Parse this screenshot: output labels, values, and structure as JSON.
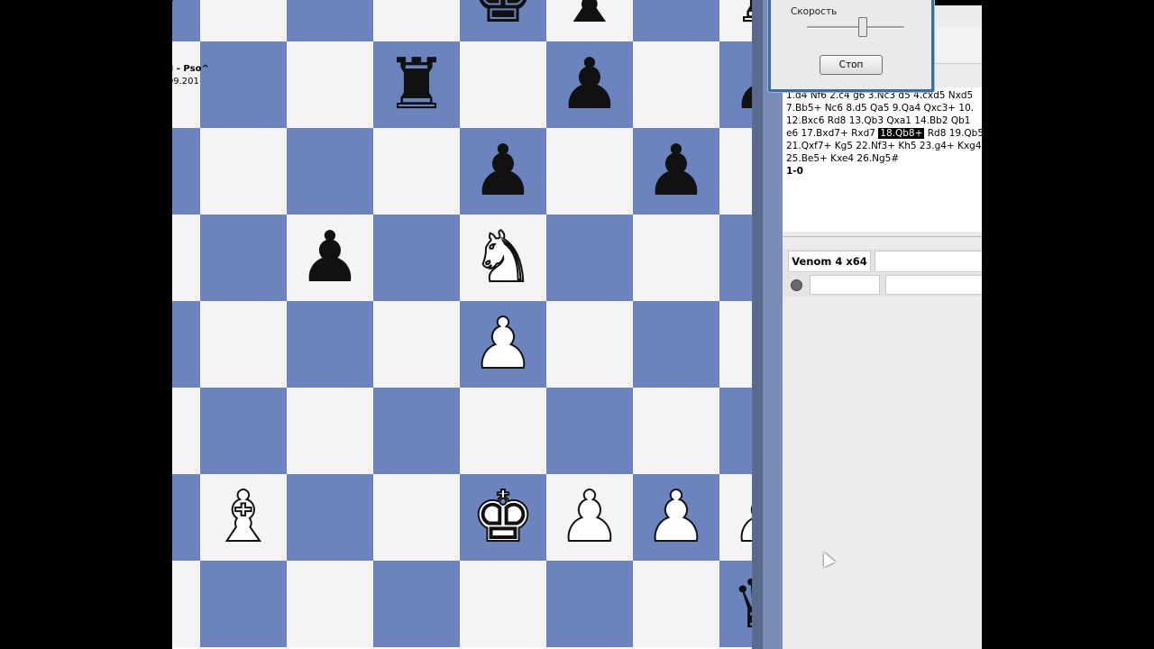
{
  "board": {
    "squares": [
      {
        "r": 0,
        "c": 0,
        "color": "dark",
        "piece": "♛",
        "side": "w"
      },
      {
        "r": 0,
        "c": 1,
        "color": "light",
        "piece": "",
        "side": ""
      },
      {
        "r": 0,
        "c": 2,
        "color": "dark",
        "piece": "",
        "side": ""
      },
      {
        "r": 0,
        "c": 3,
        "color": "light",
        "piece": "",
        "side": ""
      },
      {
        "r": 0,
        "c": 4,
        "color": "dark",
        "piece": "♚",
        "side": "b"
      },
      {
        "r": 0,
        "c": 5,
        "color": "light",
        "piece": "♝",
        "side": "b"
      },
      {
        "r": 0,
        "c": 6,
        "color": "dark",
        "piece": "",
        "side": ""
      },
      {
        "r": 0,
        "c": 7,
        "color": "light",
        "piece": "♜",
        "side": "b"
      },
      {
        "r": 1,
        "c": 0,
        "color": "light",
        "piece": "",
        "side": ""
      },
      {
        "r": 1,
        "c": 1,
        "color": "dark",
        "piece": "",
        "side": ""
      },
      {
        "r": 1,
        "c": 2,
        "color": "light",
        "piece": "",
        "side": ""
      },
      {
        "r": 1,
        "c": 3,
        "color": "dark",
        "piece": "♜",
        "side": "b"
      },
      {
        "r": 1,
        "c": 4,
        "color": "light",
        "piece": "",
        "side": ""
      },
      {
        "r": 1,
        "c": 5,
        "color": "dark",
        "piece": "♟",
        "side": "b"
      },
      {
        "r": 1,
        "c": 6,
        "color": "light",
        "piece": "",
        "side": ""
      },
      {
        "r": 1,
        "c": 7,
        "color": "dark",
        "piece": "♟",
        "side": "b"
      },
      {
        "r": 2,
        "c": 0,
        "color": "dark",
        "piece": "",
        "side": ""
      },
      {
        "r": 2,
        "c": 1,
        "color": "light",
        "piece": "",
        "side": ""
      },
      {
        "r": 2,
        "c": 2,
        "color": "dark",
        "piece": "",
        "side": ""
      },
      {
        "r": 2,
        "c": 3,
        "color": "light",
        "piece": "",
        "side": ""
      },
      {
        "r": 2,
        "c": 4,
        "color": "dark",
        "piece": "♟",
        "side": "b"
      },
      {
        "r": 2,
        "c": 5,
        "color": "light",
        "piece": "",
        "side": ""
      },
      {
        "r": 2,
        "c": 6,
        "color": "dark",
        "piece": "♟",
        "side": "b"
      },
      {
        "r": 2,
        "c": 7,
        "color": "light",
        "piece": "",
        "side": ""
      },
      {
        "r": 3,
        "c": 0,
        "color": "light",
        "piece": "",
        "side": ""
      },
      {
        "r": 3,
        "c": 1,
        "color": "dark",
        "piece": "",
        "side": ""
      },
      {
        "r": 3,
        "c": 2,
        "color": "light",
        "piece": "♟",
        "side": "b"
      },
      {
        "r": 3,
        "c": 3,
        "color": "dark",
        "piece": "",
        "side": ""
      },
      {
        "r": 3,
        "c": 4,
        "color": "light",
        "piece": "♞",
        "side": "w"
      },
      {
        "r": 3,
        "c": 5,
        "color": "dark",
        "piece": "",
        "side": ""
      },
      {
        "r": 3,
        "c": 6,
        "color": "light",
        "piece": "",
        "side": ""
      },
      {
        "r": 3,
        "c": 7,
        "color": "dark",
        "piece": "",
        "side": ""
      },
      {
        "r": 4,
        "c": 0,
        "color": "dark",
        "piece": "",
        "side": ""
      },
      {
        "r": 4,
        "c": 1,
        "color": "light",
        "piece": "",
        "side": ""
      },
      {
        "r": 4,
        "c": 2,
        "color": "dark",
        "piece": "",
        "side": ""
      },
      {
        "r": 4,
        "c": 3,
        "color": "light",
        "piece": "",
        "side": ""
      },
      {
        "r": 4,
        "c": 4,
        "color": "dark",
        "piece": "♟",
        "side": "w"
      },
      {
        "r": 4,
        "c": 5,
        "color": "light",
        "piece": "",
        "side": ""
      },
      {
        "r": 4,
        "c": 6,
        "color": "dark",
        "piece": "",
        "side": ""
      },
      {
        "r": 4,
        "c": 7,
        "color": "light",
        "piece": "",
        "side": ""
      },
      {
        "r": 5,
        "c": 0,
        "color": "light",
        "piece": "",
        "side": ""
      },
      {
        "r": 5,
        "c": 1,
        "color": "dark",
        "piece": "",
        "side": ""
      },
      {
        "r": 5,
        "c": 2,
        "color": "light",
        "piece": "",
        "side": ""
      },
      {
        "r": 5,
        "c": 3,
        "color": "dark",
        "piece": "",
        "side": ""
      },
      {
        "r": 5,
        "c": 4,
        "color": "light",
        "piece": "",
        "side": ""
      },
      {
        "r": 5,
        "c": 5,
        "color": "dark",
        "piece": "",
        "side": ""
      },
      {
        "r": 5,
        "c": 6,
        "color": "light",
        "piece": "",
        "side": ""
      },
      {
        "r": 5,
        "c": 7,
        "color": "dark",
        "piece": "",
        "side": ""
      },
      {
        "r": 6,
        "c": 0,
        "color": "dark",
        "piece": "",
        "side": ""
      },
      {
        "r": 6,
        "c": 1,
        "color": "light",
        "piece": "♝",
        "side": "w"
      },
      {
        "r": 6,
        "c": 2,
        "color": "dark",
        "piece": "",
        "side": ""
      },
      {
        "r": 6,
        "c": 3,
        "color": "light",
        "piece": "",
        "side": ""
      },
      {
        "r": 6,
        "c": 4,
        "color": "dark",
        "piece": "♚",
        "side": "w"
      },
      {
        "r": 6,
        "c": 5,
        "color": "light",
        "piece": "♟",
        "side": "w"
      },
      {
        "r": 6,
        "c": 6,
        "color": "dark",
        "piece": "♟",
        "side": "w"
      },
      {
        "r": 6,
        "c": 7,
        "color": "light",
        "piece": "♟",
        "side": "w"
      },
      {
        "r": 7,
        "c": 0,
        "color": "light",
        "piece": "",
        "side": ""
      },
      {
        "r": 7,
        "c": 1,
        "color": "dark",
        "piece": "",
        "side": ""
      },
      {
        "r": 7,
        "c": 2,
        "color": "light",
        "piece": "",
        "side": ""
      },
      {
        "r": 7,
        "c": 3,
        "color": "dark",
        "piece": "",
        "side": ""
      },
      {
        "r": 7,
        "c": 4,
        "color": "light",
        "piece": "",
        "side": ""
      },
      {
        "r": 7,
        "c": 5,
        "color": "dark",
        "piece": "",
        "side": ""
      },
      {
        "r": 7,
        "c": 6,
        "color": "light",
        "piece": "",
        "side": ""
      },
      {
        "r": 7,
        "c": 7,
        "color": "dark",
        "piece": "♛",
        "side": "b"
      }
    ]
  },
  "game": {
    "header": "ѓsPI - Рѕо^",
    "date": "04.09.201",
    "moves_line1": "1.d4  Nf6  2.c4  g6  3.Nc3  d5  4.cxd5  Nxd5",
    "moves_line2": "7.Bb5+  Nc6  8.d5  Qa5  9.Qa4  Qxc3+  10.",
    "moves_line3": "12.Bxc6  Rd8  13.Qb3  Qxa1  14.Bb2  Qb1",
    "moves_line4_pre": "e6  17.Bxd7+  Rxd7",
    "moves_line4_hl": "18.Qb8+",
    "moves_line4_post": "Rd8  19.Qb5",
    "moves_line5": "21.Qxf7+  Kg5  22.Nf3+  Kh5  23.g4+  Kxg4",
    "moves_line6": "25.Be5+  Kxe4  26.Ng5#",
    "result": "1-0"
  },
  "engine": {
    "name": "Venom 4 x64"
  },
  "dialog": {
    "speed_label": "Скорость",
    "stop_label": "Стоп"
  }
}
